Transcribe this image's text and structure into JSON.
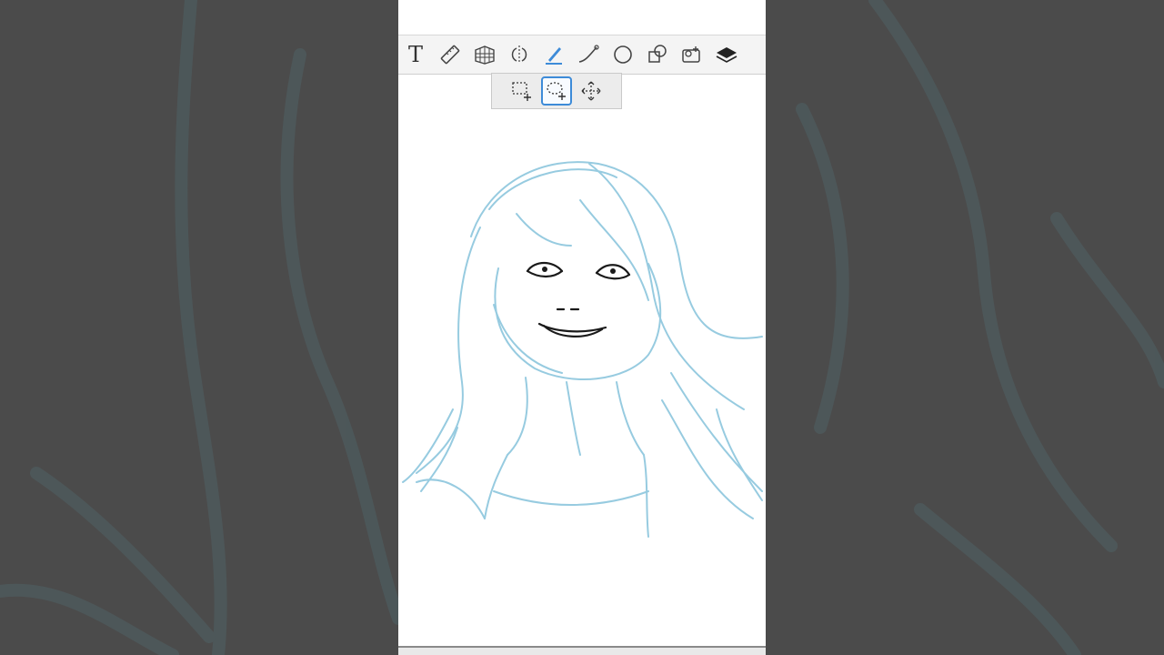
{
  "toolbar": {
    "tools": [
      {
        "name": "text",
        "icon": "text-icon",
        "label": "T"
      },
      {
        "name": "ruler",
        "icon": "ruler-icon"
      },
      {
        "name": "perspective",
        "icon": "perspective-grid-icon"
      },
      {
        "name": "symmetry",
        "icon": "symmetry-icon"
      },
      {
        "name": "brush",
        "icon": "brush-icon",
        "active": true
      },
      {
        "name": "curve",
        "icon": "curve-icon"
      },
      {
        "name": "ellipse",
        "icon": "ellipse-icon"
      },
      {
        "name": "shapes",
        "icon": "shapes-icon"
      },
      {
        "name": "reference",
        "icon": "reference-layer-icon"
      },
      {
        "name": "layers",
        "icon": "layers-icon"
      }
    ]
  },
  "selection_tools": {
    "items": [
      {
        "name": "rect-select",
        "icon": "rectangle-select-icon"
      },
      {
        "name": "lasso-select",
        "icon": "lasso-select-icon",
        "selected": true
      },
      {
        "name": "move",
        "icon": "move-icon"
      }
    ]
  },
  "colors": {
    "background_dim": "#4b4b4b",
    "sketch_blue": "#8cc6dd",
    "ink": "#1a1a1a",
    "accent": "#3d8bd8"
  }
}
